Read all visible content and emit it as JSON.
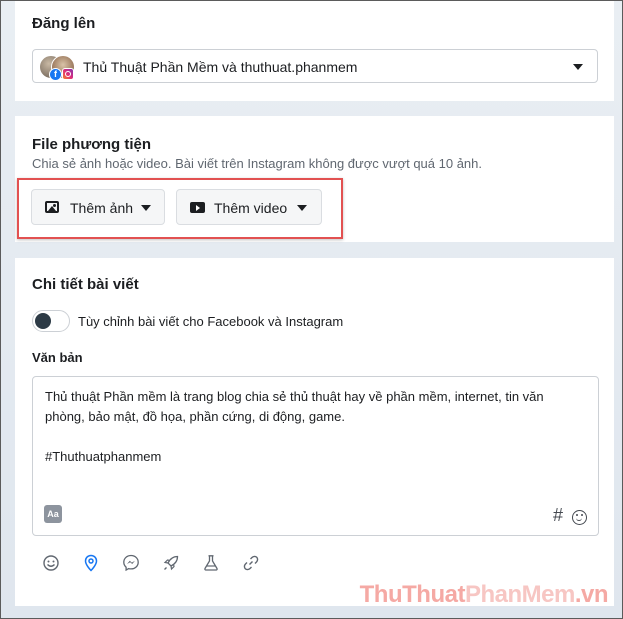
{
  "post_to": {
    "title": "Đăng lên",
    "account": "Thủ Thuật Phần Mềm và thuthuat.phanmem"
  },
  "media": {
    "title": "File phương tiện",
    "description": "Chia sẻ ảnh hoặc video. Bài viết trên Instagram không được vượt quá 10 ảnh.",
    "add_photo_label": "Thêm ảnh",
    "add_video_label": "Thêm video"
  },
  "details": {
    "title": "Chi tiết bài viết",
    "toggle_label": "Tùy chỉnh bài viết cho Facebook và Instagram",
    "toggle_on": false,
    "text_label": "Văn bản",
    "text_body": "Thủ thuật Phần mềm là trang blog chia sẻ thủ thuật hay về phần mềm, internet, tin văn phòng, bảo mật, đồ họa, phần cứng, di động, game.",
    "hashtag": "#Thuthuatphanmem",
    "format_icon_text": "Aa",
    "hash_symbol": "#"
  },
  "toolbar_icons": [
    "emoji-icon",
    "location-pin-icon",
    "messenger-icon",
    "rocket-icon",
    "flask-icon",
    "link-icon"
  ],
  "watermark": {
    "part1": "ThuThuat",
    "part2": "PhanMem",
    "part3": ".vn"
  },
  "colors": {
    "highlight": "#e25151",
    "facebook": "#1877f2",
    "toggle_knob": "#2d3b46"
  }
}
